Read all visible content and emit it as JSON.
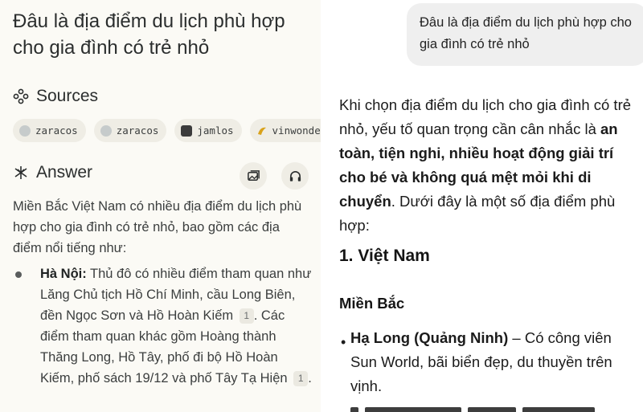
{
  "left": {
    "question": "Đâu là địa điểm du lịch phù hợp cho gia đình có trẻ nhỏ",
    "sources_label": "Sources",
    "sources": [
      {
        "name": "zaracos",
        "icon": "globe-favicon"
      },
      {
        "name": "zaracos",
        "icon": "globe-favicon"
      },
      {
        "name": "jamlos",
        "icon": "jamlos-favicon"
      },
      {
        "name": "vinwonders",
        "icon": "vinwonders-favicon"
      }
    ],
    "answer_label": "Answer",
    "answer_intro": "Miền Bắc Việt Nam có nhiều địa điểm du lịch phù hợp cho gia đình có trẻ nhỏ, bao gồm các địa điểm nổi tiếng như:",
    "bullet_title": "Hà Nội:",
    "bullet_body_1": " Thủ đô có nhiều điểm tham quan như Lăng Chủ tịch Hồ Chí Minh, cầu Long Biên, đền Ngọc Sơn và Hồ Hoàn Kiếm",
    "cite_1": "1",
    "bullet_body_2": ". Các điểm tham quan khác gồm Hoàng thành Thăng Long, Hồ Tây, phố đi bộ Hồ Hoàn Kiếm, phố sách 19/12 và phố Tây Tạ Hiện",
    "cite_2": "1",
    "bullet_end": "."
  },
  "right": {
    "user_message": "Đâu là địa điểm du lịch phù hợp cho gia đình có trẻ nhỏ",
    "intro_1": "Khi chọn địa điểm du lịch cho gia đình có trẻ nhỏ, yếu tố quan trọng cần cân nhắc là ",
    "intro_bold": "an toàn, tiện nghi, nhiều hoạt động giải trí cho bé và không quá mệt mỏi khi di chuyển",
    "intro_2": ". Dưới đây là một số địa điểm phù hợp:",
    "heading_1": "1. Việt Nam",
    "heading_2": "Miền Bắc",
    "bullet_dot": "•",
    "bullet_title": "Hạ Long (Quảng Ninh)",
    "bullet_body": " – Có công viên Sun World, bãi biển đẹp, du thuyền trên vịnh."
  }
}
